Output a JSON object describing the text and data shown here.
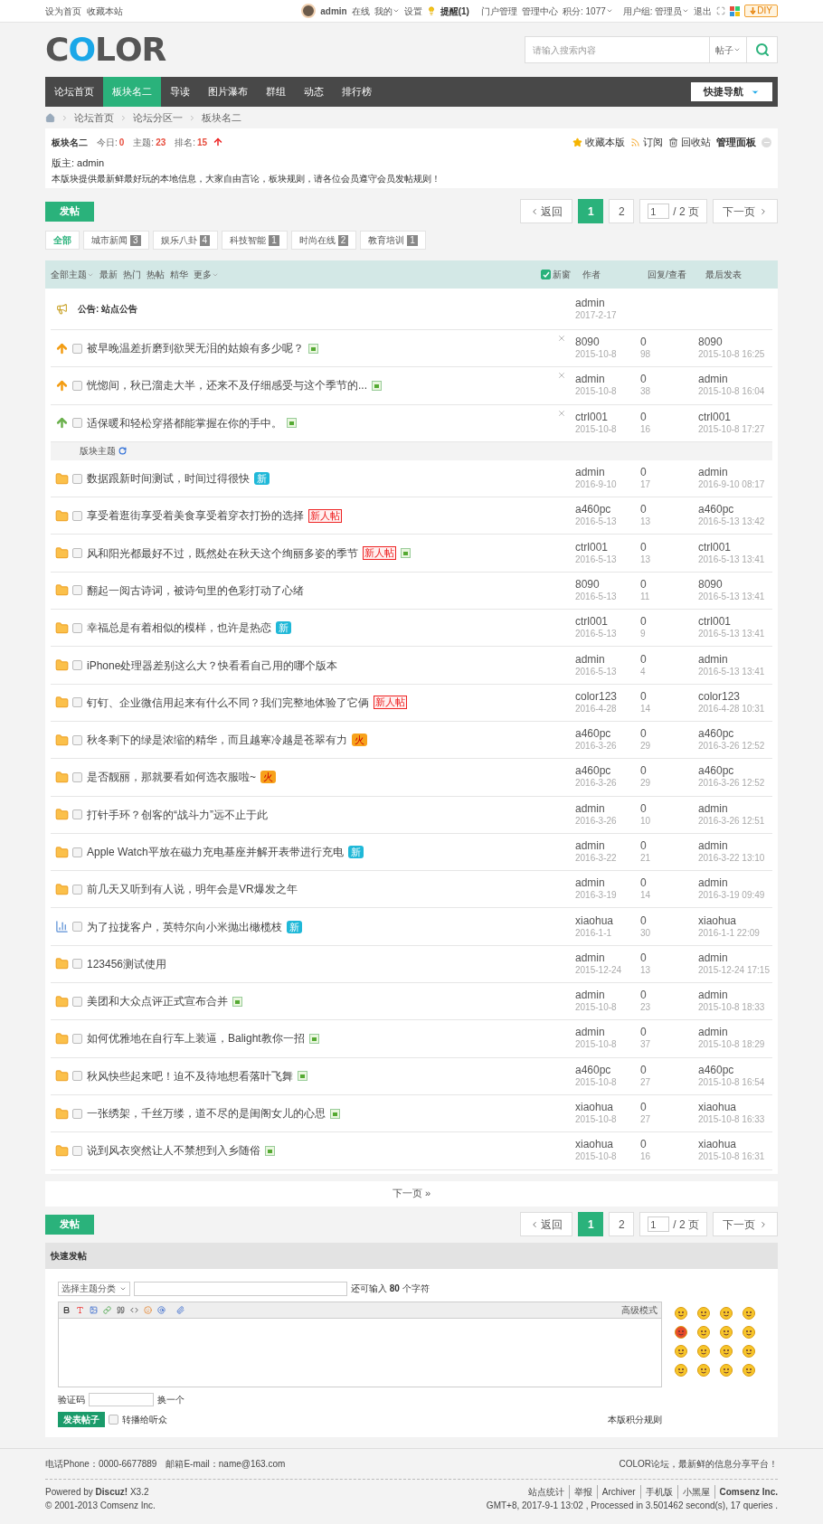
{
  "topbar": {
    "left_links": [
      "设为首页",
      "收藏本站"
    ],
    "user": "admin",
    "status": "在线",
    "menus": [
      {
        "label": "我的",
        "dropdown": true
      },
      {
        "label": "设置",
        "dropdown": false
      }
    ],
    "reminder": "提醒(1)",
    "links": [
      "门户管理",
      "管理中心"
    ],
    "points": "积分: 1077",
    "group": "用户组: 管理员",
    "logout": "退出",
    "diy": "DIY"
  },
  "logo": "COLOR",
  "search": {
    "placeholder": "请输入搜索内容",
    "scope": "帖子"
  },
  "nav": [
    {
      "label": "论坛首页",
      "selected": false
    },
    {
      "label": "板块名二",
      "selected": true
    },
    {
      "label": "导读",
      "selected": false
    },
    {
      "label": "图片瀑布",
      "selected": false
    },
    {
      "label": "群组",
      "selected": false
    },
    {
      "label": "动态",
      "selected": false
    },
    {
      "label": "排行榜",
      "selected": false
    }
  ],
  "quick_nav": "快捷导航",
  "breadcrumb": [
    "论坛首页",
    "论坛分区一",
    "板块名二"
  ],
  "forum": {
    "name": "板块名二",
    "stats": [
      {
        "label": "今日:",
        "value": "0"
      },
      {
        "label": "主题:",
        "value": "23"
      },
      {
        "label": "排名:",
        "value": "15"
      }
    ],
    "actions": [
      {
        "kind": "star",
        "label": "收藏本版"
      },
      {
        "kind": "rss",
        "label": "订阅"
      },
      {
        "kind": "trash",
        "label": "回收站"
      },
      {
        "kind": "plain",
        "label": "管理面板"
      }
    ],
    "moderator": "版主: admin",
    "description": "本版块提供最新鲜最好玩的本地信息，大家自由言论，板块规则，请各位会员遵守会员发帖规则！"
  },
  "post_button_top": "发帖",
  "post_button_bottom": "发帖",
  "pagination_top": {
    "back": "返回",
    "pages": [
      {
        "label": "1",
        "selected": true
      },
      {
        "label": "2",
        "selected": false
      }
    ],
    "page_input": "1",
    "total": "/ 2 页",
    "next": "下一页"
  },
  "filters": [
    {
      "label": "全部",
      "selected": true
    },
    {
      "label": "城市新闻",
      "count": "3",
      "selected": false
    },
    {
      "label": "娱乐八卦",
      "count": "4",
      "selected": false
    },
    {
      "label": "科技智能",
      "count": "1",
      "selected": false
    },
    {
      "label": "时尚在线",
      "count": "2",
      "selected": false
    },
    {
      "label": "教育培训",
      "count": "1",
      "selected": false
    }
  ],
  "table": {
    "sort_tabs": [
      {
        "label": "全部主题",
        "caret": true
      },
      {
        "label": "最新",
        "caret": false
      },
      {
        "label": "热门",
        "caret": false
      },
      {
        "label": "热帖",
        "caret": false
      },
      {
        "label": "精华",
        "caret": false
      },
      {
        "label": "更多",
        "caret": true
      }
    ],
    "new_window": {
      "label": "新窗",
      "checked": true
    },
    "columns": [
      "作者",
      "回复/查看",
      "最后发表"
    ]
  },
  "announcement": {
    "title": "公告: 站点公告",
    "author": "admin",
    "date": "2017-2-17"
  },
  "sticky_threads": [
    {
      "title": "被早晚温差折磨到欲哭无泪的姑娘有多少呢？",
      "color": "#f39c12",
      "checked": false,
      "badges": [
        {
          "kind": "pic"
        }
      ],
      "author": "8090",
      "date": "2015-10-8",
      "replies": "0",
      "views": "98",
      "last_author": "8090",
      "last_time": "2015-10-8 16:25"
    },
    {
      "title": "恍惚间，秋已溜走大半，还来不及仔细感受与这个季节的...",
      "color": "#f39c12",
      "checked": false,
      "badges": [
        {
          "kind": "pic"
        }
      ],
      "author": "admin",
      "date": "2015-10-8",
      "replies": "0",
      "views": "38",
      "last_author": "admin",
      "last_time": "2015-10-8 16:04"
    },
    {
      "title": "适保暖和轻松穿搭都能掌握在你的手中。",
      "color": "#6ab04c",
      "checked": false,
      "badges": [
        {
          "kind": "pic"
        }
      ],
      "author": "ctrl001",
      "date": "2015-10-8",
      "replies": "0",
      "views": "16",
      "last_author": "ctrl001",
      "last_time": "2015-10-8 17:27"
    }
  ],
  "section_label": "版块主题",
  "threads": [
    {
      "kind": "folder",
      "title": "数据跟新时间测试，时间过得很快",
      "checked": false,
      "badges": [
        {
          "kind": "new",
          "label": "新"
        }
      ],
      "author": "admin",
      "date": "2016-9-10",
      "replies": "0",
      "views": "17",
      "last_author": "admin",
      "last_time": "2016-9-10 08:17"
    },
    {
      "kind": "folder",
      "title": "享受着逛街享受着美食享受着穿衣打扮的选择",
      "checked": false,
      "badges": [
        {
          "kind": "newbie",
          "label": "新人帖"
        }
      ],
      "author": "a460pc",
      "date": "2016-5-13",
      "replies": "0",
      "views": "13",
      "last_author": "a460pc",
      "last_time": "2016-5-13 13:42"
    },
    {
      "kind": "folder",
      "title": "风和阳光都最好不过，既然处在秋天这个绚丽多姿的季节",
      "checked": false,
      "badges": [
        {
          "kind": "newbie",
          "label": "新人帖"
        },
        {
          "kind": "pic"
        }
      ],
      "author": "ctrl001",
      "date": "2016-5-13",
      "replies": "0",
      "views": "13",
      "last_author": "ctrl001",
      "last_time": "2016-5-13 13:41"
    },
    {
      "kind": "folder",
      "title": "翻起一阅古诗词，被诗句里的色彩打动了心绪",
      "checked": false,
      "author": "8090",
      "date": "2016-5-13",
      "replies": "0",
      "views": "11",
      "last_author": "8090",
      "last_time": "2016-5-13 13:41"
    },
    {
      "kind": "folder",
      "title": "幸福总是有着相似的模样，也许是热恋",
      "checked": false,
      "badges": [
        {
          "kind": "new",
          "label": "新"
        }
      ],
      "author": "ctrl001",
      "date": "2016-5-13",
      "replies": "0",
      "views": "9",
      "last_author": "ctrl001",
      "last_time": "2016-5-13 13:41"
    },
    {
      "kind": "folder",
      "title": "iPhone处理器差别这么大？快看看自己用的哪个版本",
      "checked": false,
      "author": "admin",
      "date": "2016-5-13",
      "replies": "0",
      "views": "4",
      "last_author": "admin",
      "last_time": "2016-5-13 13:41"
    },
    {
      "kind": "folder",
      "title": "钉钉、企业微信用起来有什么不同？我们完整地体验了它俩",
      "checked": false,
      "badges": [
        {
          "kind": "newbie",
          "label": "新人帖"
        }
      ],
      "author": "color123",
      "date": "2016-4-28",
      "replies": "0",
      "views": "14",
      "last_author": "color123",
      "last_time": "2016-4-28 10:31"
    },
    {
      "kind": "folder",
      "title": "秋冬剩下的绿是浓缩的精华，而且越寒冷越是苍翠有力",
      "checked": false,
      "badges": [
        {
          "kind": "hot",
          "label": "火"
        }
      ],
      "author": "a460pc",
      "date": "2016-3-26",
      "replies": "0",
      "views": "29",
      "last_author": "a460pc",
      "last_time": "2016-3-26 12:52"
    },
    {
      "kind": "folder",
      "title": "是否靓丽，那就要看如何选衣服啦~",
      "checked": false,
      "badges": [
        {
          "kind": "hot",
          "label": "火"
        }
      ],
      "author": "a460pc",
      "date": "2016-3-26",
      "replies": "0",
      "views": "29",
      "last_author": "a460pc",
      "last_time": "2016-3-26 12:52"
    },
    {
      "kind": "folder",
      "title": "打针手环？创客的“战斗力”远不止于此",
      "checked": false,
      "author": "admin",
      "date": "2016-3-26",
      "replies": "0",
      "views": "10",
      "last_author": "admin",
      "last_time": "2016-3-26 12:51"
    },
    {
      "kind": "folder",
      "title": "Apple Watch平放在磁力充电基座并解开表带进行充电",
      "checked": false,
      "badges": [
        {
          "kind": "new",
          "label": "新"
        }
      ],
      "author": "admin",
      "date": "2016-3-22",
      "replies": "0",
      "views": "21",
      "last_author": "admin",
      "last_time": "2016-3-22 13:10"
    },
    {
      "kind": "folder",
      "title": "前几天又听到有人说，明年会是VR爆发之年",
      "checked": false,
      "author": "admin",
      "date": "2016-3-19",
      "replies": "0",
      "views": "14",
      "last_author": "admin",
      "last_time": "2016-3-19 09:49"
    },
    {
      "kind": "poll",
      "title": "为了拉拢客户，英特尔向小米抛出橄榄枝",
      "checked": false,
      "badges": [
        {
          "kind": "new",
          "label": "新"
        }
      ],
      "author": "xiaohua",
      "date": "2016-1-1",
      "replies": "0",
      "views": "30",
      "last_author": "xiaohua",
      "last_time": "2016-1-1 22:09"
    },
    {
      "kind": "folder",
      "title": "123456测试使用",
      "checked": false,
      "author": "admin",
      "date": "2015-12-24",
      "replies": "0",
      "views": "13",
      "last_author": "admin",
      "last_time": "2015-12-24 17:15"
    },
    {
      "kind": "folder",
      "title": "美团和大众点评正式宣布合并",
      "checked": false,
      "badges": [
        {
          "kind": "pic"
        }
      ],
      "author": "admin",
      "date": "2015-10-8",
      "replies": "0",
      "views": "23",
      "last_author": "admin",
      "last_time": "2015-10-8 18:33"
    },
    {
      "kind": "folder",
      "title": "如何优雅地在自行车上装逼，Balight教你一招",
      "checked": false,
      "badges": [
        {
          "kind": "pic"
        }
      ],
      "author": "admin",
      "date": "2015-10-8",
      "replies": "0",
      "views": "37",
      "last_author": "admin",
      "last_time": "2015-10-8 18:29"
    },
    {
      "kind": "folder",
      "title": "秋风快些起来吧！迫不及待地想看落叶飞舞",
      "checked": false,
      "badges": [
        {
          "kind": "pic"
        }
      ],
      "author": "a460pc",
      "date": "2015-10-8",
      "replies": "0",
      "views": "27",
      "last_author": "a460pc",
      "last_time": "2015-10-8 16:54"
    },
    {
      "kind": "folder",
      "title": "一张绣架，千丝万缕，道不尽的是闺阁女儿的心思",
      "checked": false,
      "badges": [
        {
          "kind": "pic"
        }
      ],
      "author": "xiaohua",
      "date": "2015-10-8",
      "replies": "0",
      "views": "27",
      "last_author": "xiaohua",
      "last_time": "2015-10-8 16:33"
    },
    {
      "kind": "folder",
      "title": "说到风衣突然让人不禁想到入乡随俗",
      "checked": false,
      "badges": [
        {
          "kind": "pic"
        }
      ],
      "author": "xiaohua",
      "date": "2015-10-8",
      "replies": "0",
      "views": "16",
      "last_author": "xiaohua",
      "last_time": "2015-10-8 16:31"
    }
  ],
  "next_page": "下一页 »",
  "pagination_bottom": {
    "back": "返回",
    "pages": [
      {
        "label": "1",
        "selected": true
      },
      {
        "label": "2",
        "selected": false
      }
    ],
    "page_input": "1",
    "total": "/ 2 页",
    "next": "下一页"
  },
  "quick_post": {
    "title": "快速发帖",
    "category": "选择主题分类",
    "char_hint": "还可输入 **80** 个字符",
    "advanced": "高级模式",
    "captcha_label": "验证码",
    "captcha_change": "换一个",
    "submit": "发表帖子",
    "broadcast": {
      "label": "转播给听众",
      "checked": false
    },
    "rules": "本版积分规则"
  },
  "footer": {
    "phone": "电话Phone：0000-6677889",
    "email": "邮箱E-mail：name@163.com",
    "slogan": "COLOR论坛，最新鲜的信息分享平台！",
    "powered": "Powered by **Discuz!** X3.2",
    "copyright": "© 2001-2013 Comsenz Inc.",
    "links": [
      {
        "label": "站点统计",
        "bold": false
      },
      {
        "label": "举报",
        "bold": false
      },
      {
        "label": "Archiver",
        "bold": false
      },
      {
        "label": "手机版",
        "bold": false
      },
      {
        "label": "小黑屋",
        "bold": false
      },
      {
        "label": "Comsenz Inc.",
        "bold": true
      }
    ],
    "stats": "GMT+8, 2017-9-1 13:02 , Processed in 3.501462 second(s), 17 queries ."
  }
}
